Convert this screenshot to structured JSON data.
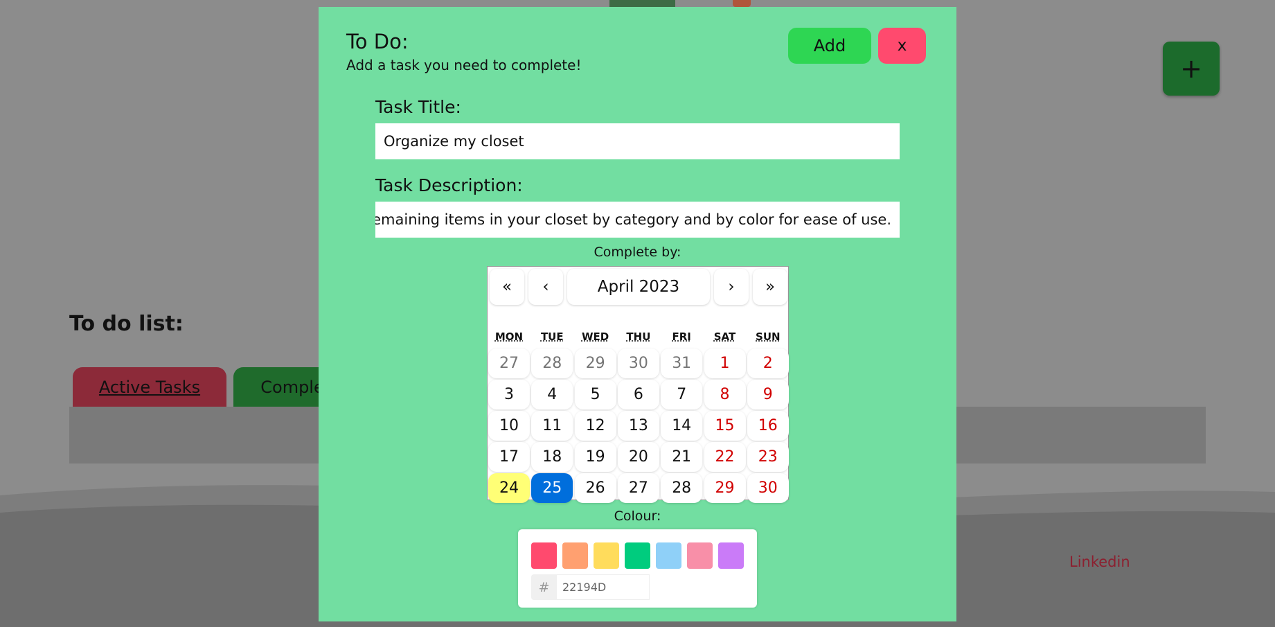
{
  "background": {
    "heading": "To do list:",
    "tabs": [
      {
        "label": "Active Tasks"
      },
      {
        "label": "Comple"
      }
    ],
    "plus_label": "+",
    "footer_link": "Linkedin"
  },
  "modal": {
    "title": "To Do:",
    "subtitle": "Add a task you need to complete!",
    "add_label": "Add",
    "close_label": "x",
    "task_title_label": "Task Title:",
    "task_title_value": "Organize my closet",
    "task_desc_label": "Task Description:",
    "task_desc_value": "Organize the remaining items in your closet by category and by color for ease of use.",
    "complete_by_label": "Complete by:",
    "colour_label": "Colour:"
  },
  "calendar": {
    "nav": {
      "prev2": "«",
      "prev": "‹",
      "month_label": "April 2023",
      "next": "›",
      "next2": "»"
    },
    "weekdays": [
      "MON",
      "TUE",
      "WED",
      "THU",
      "FRI",
      "SAT",
      "SUN"
    ],
    "weeks": [
      [
        "27",
        "28",
        "29",
        "30",
        "31",
        "1",
        "2"
      ],
      [
        "3",
        "4",
        "5",
        "6",
        "7",
        "8",
        "9"
      ],
      [
        "10",
        "11",
        "12",
        "13",
        "14",
        "15",
        "16"
      ],
      [
        "17",
        "18",
        "19",
        "20",
        "21",
        "22",
        "23"
      ],
      [
        "24",
        "25",
        "26",
        "27",
        "28",
        "29",
        "30"
      ]
    ],
    "today": "24",
    "selected": "25"
  },
  "colour_picker": {
    "swatches": [
      "#FF4A6E",
      "#FFA070",
      "#FFDC5C",
      "#00CC7E",
      "#8FD0F8",
      "#F88FA8",
      "#CA7BF8"
    ],
    "hash_symbol": "#",
    "hex_value": "22194D"
  },
  "colors": {
    "modal_bg": "#72DEA1",
    "add_button": "#2ED653",
    "close_button": "#FF4A6E",
    "selected_day": "#006EDC",
    "today": "#FFFF76",
    "weekend_text": "#D10000"
  }
}
